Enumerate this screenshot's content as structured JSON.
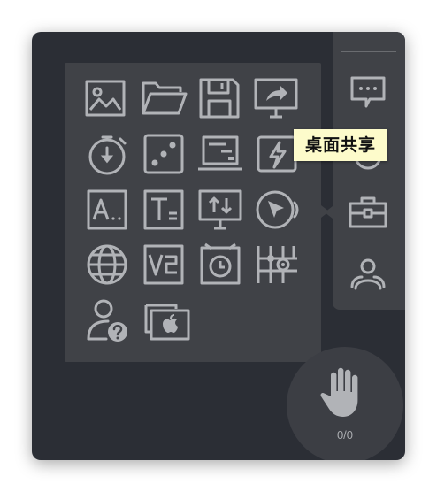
{
  "colors": {
    "window_bg": "#2b2e35",
    "panel_bg": "#404247",
    "icon_gray": "#b1b3b7",
    "tooltip_bg": "#fdfbcb",
    "hand_button_bg": "#3c3e44"
  },
  "toolbox": {
    "tools": [
      {
        "icon": "image-icon"
      },
      {
        "icon": "folder-open-icon"
      },
      {
        "icon": "save-disk-icon"
      },
      {
        "icon": "screen-share-arrow-icon"
      },
      {
        "icon": "stopwatch-icon"
      },
      {
        "icon": "dice-icon"
      },
      {
        "icon": "laptop-screen-icon"
      },
      {
        "icon": "flash-icon"
      },
      {
        "icon": "text-a-icon"
      },
      {
        "icon": "text-t-icon"
      },
      {
        "icon": "screen-sync-icon"
      },
      {
        "icon": "cursor-circle-icon"
      },
      {
        "icon": "globe-icon"
      },
      {
        "icon": "vz-icon"
      },
      {
        "icon": "alarm-clock-icon"
      },
      {
        "icon": "grid-nodes-icon"
      },
      {
        "icon": "user-question-icon"
      },
      {
        "icon": "apple-screen-icon"
      }
    ]
  },
  "tooltip": {
    "text": "桌面共享"
  },
  "sidebar": {
    "buttons": [
      {
        "icon": "chat-icon"
      },
      {
        "icon": "record-icon"
      },
      {
        "icon": "toolbox-icon"
      },
      {
        "icon": "users-icon"
      }
    ]
  },
  "raise_hand": {
    "icon": "hand-icon",
    "count": "0/0"
  }
}
